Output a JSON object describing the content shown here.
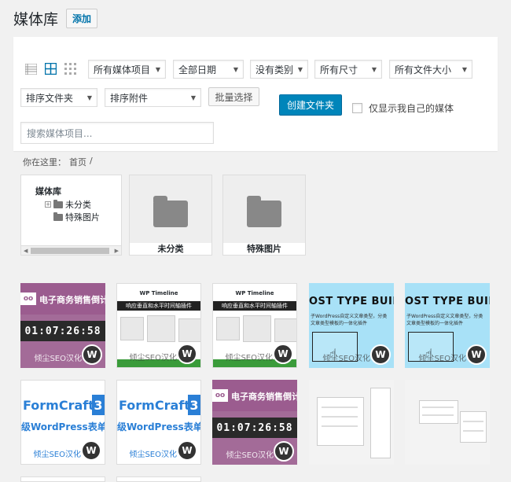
{
  "header": {
    "title": "媒体库",
    "add_label": "添加"
  },
  "toolbar": {
    "filters": [
      {
        "id": "media-type",
        "value": "所有媒体项目"
      },
      {
        "id": "date",
        "value": "全部日期"
      },
      {
        "id": "category",
        "value": "没有类别"
      },
      {
        "id": "size",
        "value": "所有尺寸"
      },
      {
        "id": "filesize",
        "value": "所有文件大小"
      }
    ],
    "sort_folder": "排序文件夹",
    "sort_attach": "排序附件",
    "bulk_select": "批量选择",
    "create_folder": "创建文件夹",
    "only_mine": "仅显示我自己的媒体",
    "search_placeholder": "搜索媒体项目..."
  },
  "breadcrumb": {
    "prefix": "你在这里：",
    "home": "首页",
    "sep": "/"
  },
  "tree": {
    "title": "媒体库",
    "items": [
      "未分类",
      "特殊图片"
    ]
  },
  "folders": [
    {
      "label": "未分类"
    },
    {
      "label": "特殊图片"
    }
  ],
  "thumbs": {
    "woo_text": "电子商务销售倒计",
    "woo_logo": "oo",
    "timer": "01:07:26:58",
    "timeline_title": "WP Timeline",
    "timeline_bar": "响应垂直和水平时间轴插件",
    "ptb_title": "OST TYPE BUILDER",
    "ptb_text_1": "子WordPress自定义文章类型，分类",
    "ptb_text_2": "文章类型模板的一体化插件",
    "fc_title": "FormCraft",
    "fc_num": "3",
    "fc_sub": "级WordPress表单插",
    "watermark": "倾尘SEO汉化",
    "wp_badge": "W"
  },
  "colors": {
    "accent": "#0085ba",
    "woo_purple": "#9b5c8f",
    "ptb_blue": "#a8e1f7",
    "fc_blue": "#2a7fd6"
  }
}
